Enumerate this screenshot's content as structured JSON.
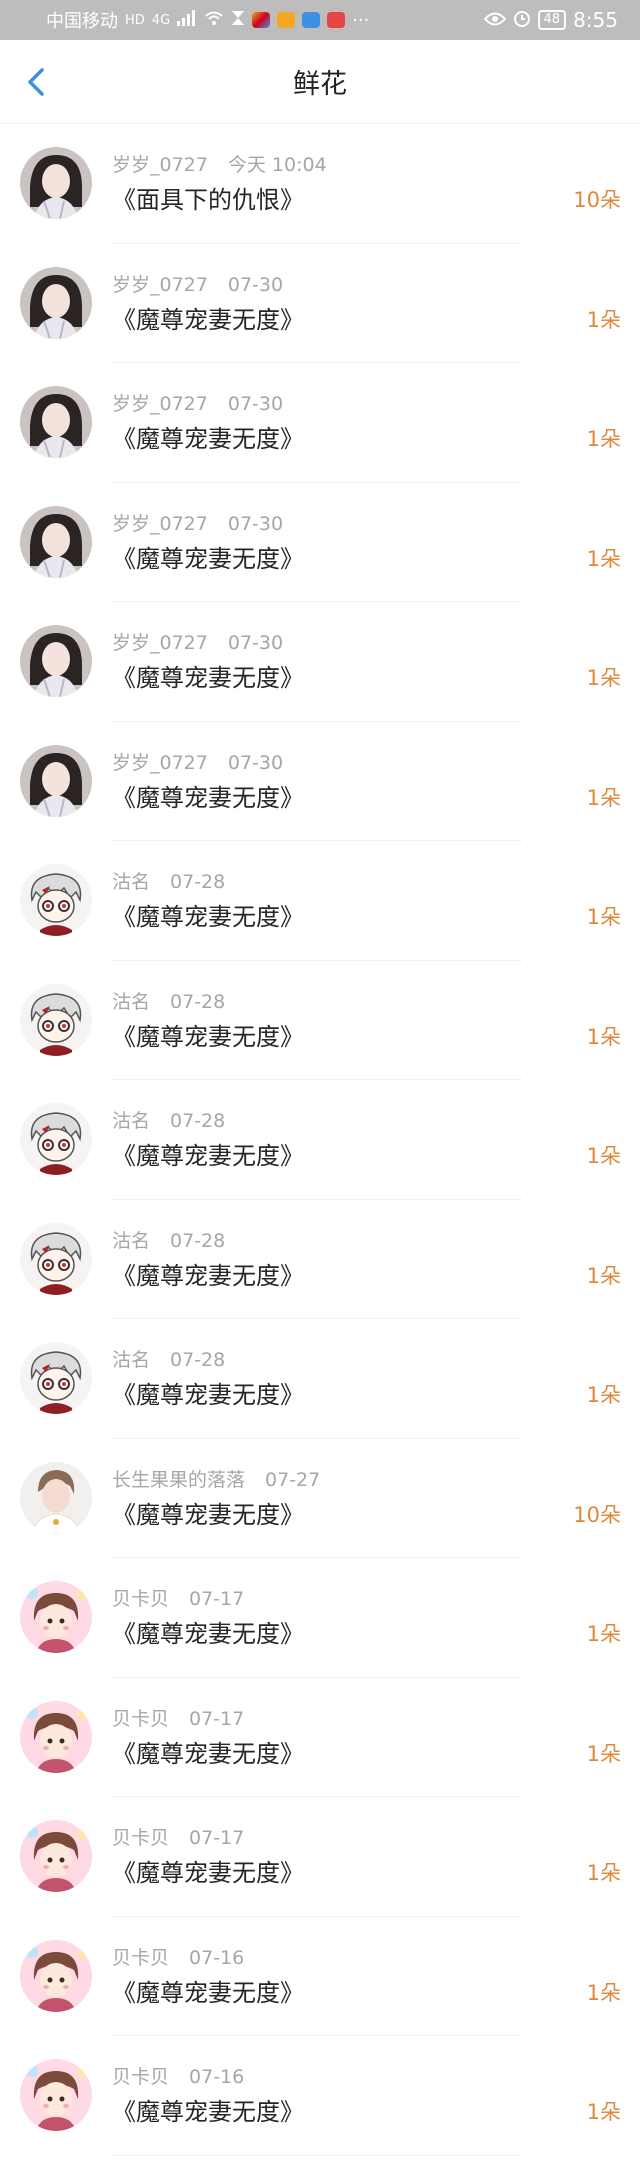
{
  "status_bar": {
    "carrier": "中国移动",
    "hd_badge": "HD",
    "network": "4G",
    "battery": "48",
    "time": "8:55"
  },
  "header": {
    "title": "鲜花"
  },
  "items": [
    {
      "user": "岁岁_0727",
      "date": "今天 10:04",
      "book": "《面具下的仇恨》",
      "count": "10朵",
      "avatar": "girl-photo-avatar"
    },
    {
      "user": "岁岁_0727",
      "date": "07-30",
      "book": "《魔尊宠妻无度》",
      "count": "1朵",
      "avatar": "girl-photo-avatar"
    },
    {
      "user": "岁岁_0727",
      "date": "07-30",
      "book": "《魔尊宠妻无度》",
      "count": "1朵",
      "avatar": "girl-photo-avatar"
    },
    {
      "user": "岁岁_0727",
      "date": "07-30",
      "book": "《魔尊宠妻无度》",
      "count": "1朵",
      "avatar": "girl-photo-avatar"
    },
    {
      "user": "岁岁_0727",
      "date": "07-30",
      "book": "《魔尊宠妻无度》",
      "count": "1朵",
      "avatar": "girl-photo-avatar"
    },
    {
      "user": "岁岁_0727",
      "date": "07-30",
      "book": "《魔尊宠妻无度》",
      "count": "1朵",
      "avatar": "girl-photo-avatar"
    },
    {
      "user": "沽名",
      "date": "07-28",
      "book": "《魔尊宠妻无度》",
      "count": "1朵",
      "avatar": "anime-boy-glasses-avatar"
    },
    {
      "user": "沽名",
      "date": "07-28",
      "book": "《魔尊宠妻无度》",
      "count": "1朵",
      "avatar": "anime-boy-glasses-avatar"
    },
    {
      "user": "沽名",
      "date": "07-28",
      "book": "《魔尊宠妻无度》",
      "count": "1朵",
      "avatar": "anime-boy-glasses-avatar"
    },
    {
      "user": "沽名",
      "date": "07-28",
      "book": "《魔尊宠妻无度》",
      "count": "1朵",
      "avatar": "anime-boy-glasses-avatar"
    },
    {
      "user": "沽名",
      "date": "07-28",
      "book": "《魔尊宠妻无度》",
      "count": "1朵",
      "avatar": "anime-boy-glasses-avatar"
    },
    {
      "user": "长生果果的落落",
      "date": "07-27",
      "book": "《魔尊宠妻无度》",
      "count": "10朵",
      "avatar": "boy-photo-avatar"
    },
    {
      "user": "贝卡贝",
      "date": "07-17",
      "book": "《魔尊宠妻无度》",
      "count": "1朵",
      "avatar": "cartoon-girl-avatar"
    },
    {
      "user": "贝卡贝",
      "date": "07-17",
      "book": "《魔尊宠妻无度》",
      "count": "1朵",
      "avatar": "cartoon-girl-avatar"
    },
    {
      "user": "贝卡贝",
      "date": "07-17",
      "book": "《魔尊宠妻无度》",
      "count": "1朵",
      "avatar": "cartoon-girl-avatar"
    },
    {
      "user": "贝卡贝",
      "date": "07-16",
      "book": "《魔尊宠妻无度》",
      "count": "1朵",
      "avatar": "cartoon-girl-avatar"
    },
    {
      "user": "贝卡贝",
      "date": "07-16",
      "book": "《魔尊宠妻无度》",
      "count": "1朵",
      "avatar": "cartoon-girl-avatar"
    }
  ],
  "colors": {
    "accent": "#e0893c",
    "back_arrow": "#3d8fe0",
    "meta_text": "#a6a6a6",
    "status_bar_bg": "#bdbdbd"
  }
}
